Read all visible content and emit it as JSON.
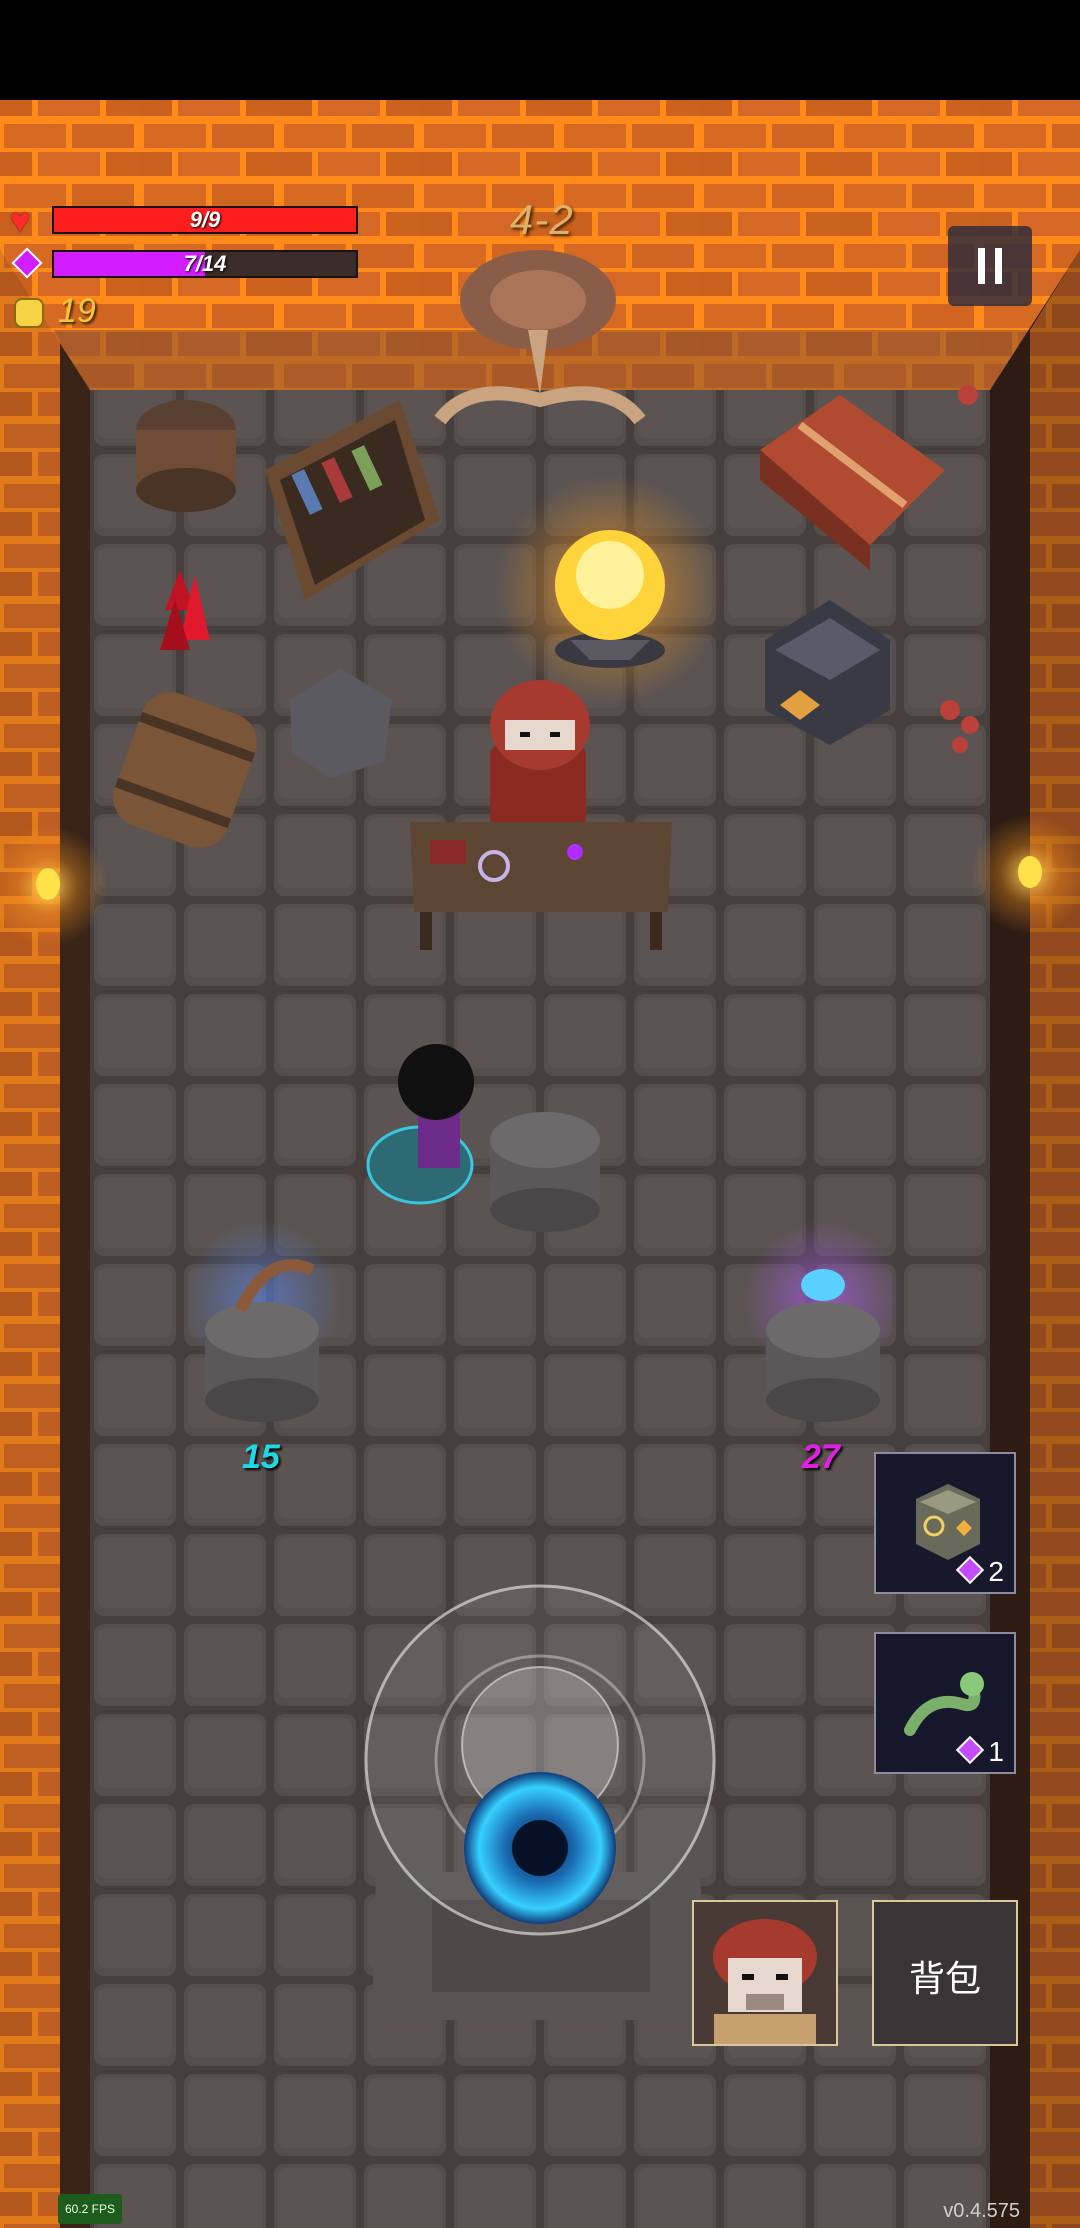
{
  "hud": {
    "health": {
      "label": "9/9",
      "current": 9,
      "max": 9,
      "color": "#ff1e1e"
    },
    "mana": {
      "label": "7/14",
      "current": 7,
      "max": 14,
      "color": "#d21eff"
    },
    "gold": "19",
    "level": "4-2",
    "pause_icon": "pause-icon"
  },
  "shop": {
    "left_pedestal": {
      "item": "boomerang-horn",
      "price": "15",
      "price_color": "#1ed8e6"
    },
    "right_pedestal": {
      "item": "blue-orb-jar",
      "price": "27",
      "price_color": "#e51ee6"
    }
  },
  "skills": [
    {
      "name": "skill-slot-cube",
      "cost": "2"
    },
    {
      "name": "skill-slot-serpent",
      "cost": "1"
    }
  ],
  "buttons": {
    "bag": "背包",
    "portrait": "merchant-portrait"
  },
  "footer": {
    "fps": "60.2 FPS",
    "version": "v0.4.575"
  }
}
